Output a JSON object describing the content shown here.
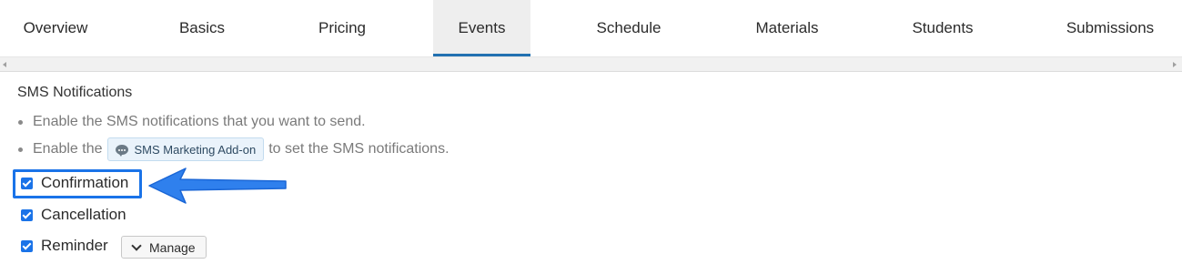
{
  "tabs": [
    {
      "label": "Overview"
    },
    {
      "label": "Basics"
    },
    {
      "label": "Pricing"
    },
    {
      "label": "Events",
      "active": true
    },
    {
      "label": "Schedule"
    },
    {
      "label": "Materials"
    },
    {
      "label": "Students"
    },
    {
      "label": "Submissions"
    }
  ],
  "section": {
    "title": "SMS Notifications",
    "bullet1": "Enable the SMS notifications that you want to send.",
    "bullet2_prefix": "Enable the",
    "addon_label": "SMS Marketing Add-on",
    "addon_icon": "chat-bubble-icon",
    "bullet2_suffix": "to set the SMS notifications."
  },
  "notifications": [
    {
      "label": "Confirmation",
      "checked": true,
      "highlighted": true
    },
    {
      "label": "Cancellation",
      "checked": true
    },
    {
      "label": "Reminder",
      "checked": true
    }
  ],
  "manage_button": {
    "label": "Manage",
    "icon": "chevron-down-icon"
  },
  "colors": {
    "accent": "#1a73e8",
    "active_tab_bg": "#eeeeee",
    "active_tab_underline": "#2271b1",
    "muted_text": "#7a7a7a"
  }
}
